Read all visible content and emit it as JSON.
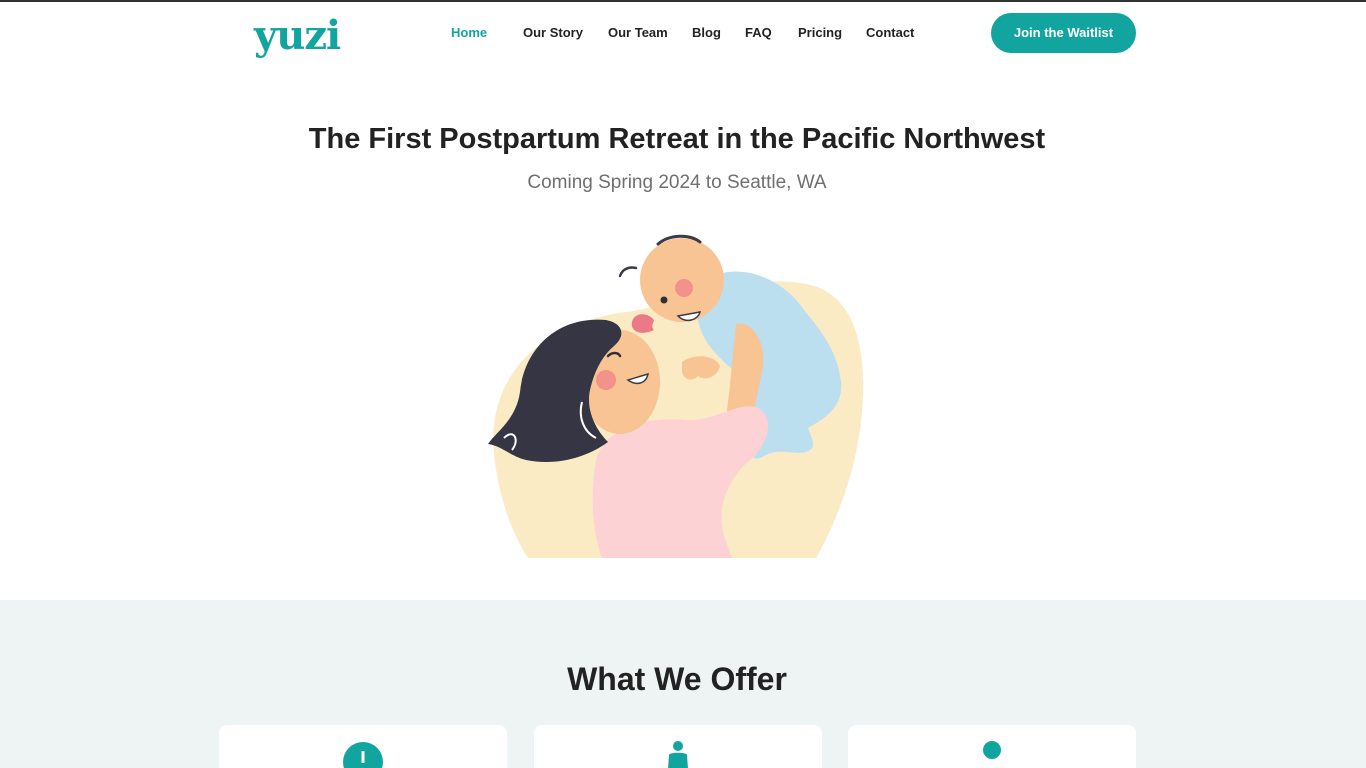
{
  "header": {
    "logo": "yuzi",
    "nav": [
      "Home",
      "Our Story",
      "Our Team",
      "Blog",
      "FAQ",
      "Pricing",
      "Contact"
    ],
    "active": "Home",
    "cta_label": "Join the Waitlist"
  },
  "hero": {
    "title": "The First Postpartum Retreat in the Pacific Northwest",
    "subtitle": "Coming Spring 2024 to Seattle, WA",
    "illustration": "mother-lifting-baby-illustration"
  },
  "offer": {
    "title": "What We Offer",
    "cards": [
      {
        "icon": "clock-icon"
      },
      {
        "icon": "person-icon"
      },
      {
        "icon": "user-icon"
      }
    ]
  },
  "colors": {
    "brand": "#12a5a0",
    "offer_bg": "#edf4f3",
    "text": "#222222",
    "muted": "#6f6f6f"
  }
}
